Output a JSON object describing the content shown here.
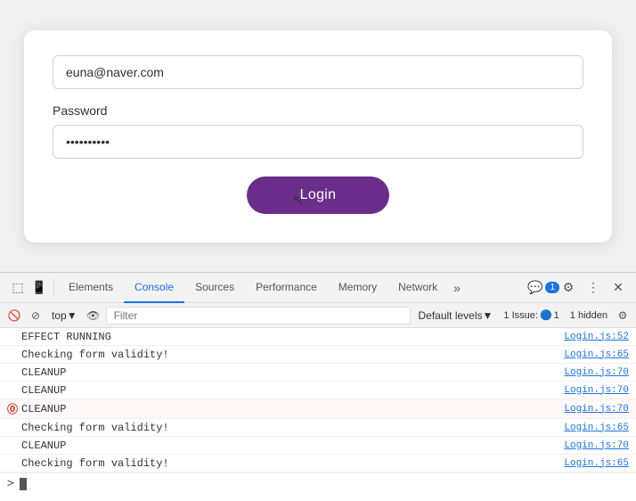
{
  "page": {
    "email_value": "euna@naver.com",
    "password_label": "Password",
    "password_dots": "••••••••••",
    "login_button": "Login"
  },
  "devtools": {
    "tabs": [
      {
        "id": "elements",
        "label": "Elements",
        "active": false
      },
      {
        "id": "console",
        "label": "Console",
        "active": true
      },
      {
        "id": "sources",
        "label": "Sources",
        "active": false
      },
      {
        "id": "performance",
        "label": "Performance",
        "active": false
      },
      {
        "id": "memory",
        "label": "Memory",
        "active": false
      },
      {
        "id": "network",
        "label": "Network",
        "active": false
      }
    ],
    "message_count": "1",
    "toolbar": {
      "top_label": "top",
      "filter_placeholder": "Filter",
      "default_levels": "Default levels",
      "issue_label": "1 Issue:",
      "issue_count": "1",
      "hidden_label": "1 hidden"
    },
    "logs": [
      {
        "id": 1,
        "text": "EFFECT RUNNING",
        "source": "Login.js:52",
        "type": "normal",
        "has_error": false
      },
      {
        "id": 2,
        "text": "Checking form validity!",
        "source": "Login.js:65",
        "type": "normal",
        "has_error": false
      },
      {
        "id": 3,
        "text": "CLEANUP",
        "source": "Login.js:70",
        "type": "normal",
        "has_error": false
      },
      {
        "id": 4,
        "text": "CLEANUP",
        "source": "Login.js:70",
        "type": "normal",
        "has_error": false
      },
      {
        "id": 5,
        "text": "CLEANUP",
        "source": "Login.js:70",
        "type": "error",
        "has_error": true
      },
      {
        "id": 6,
        "text": "Checking form validity!",
        "source": "Login.js:65",
        "type": "normal",
        "has_error": false
      },
      {
        "id": 7,
        "text": "CLEANUP",
        "source": "Login.js:70",
        "type": "normal",
        "has_error": false
      },
      {
        "id": 8,
        "text": "Checking form validity!",
        "source": "Login.js:65",
        "type": "normal",
        "has_error": false
      }
    ]
  }
}
